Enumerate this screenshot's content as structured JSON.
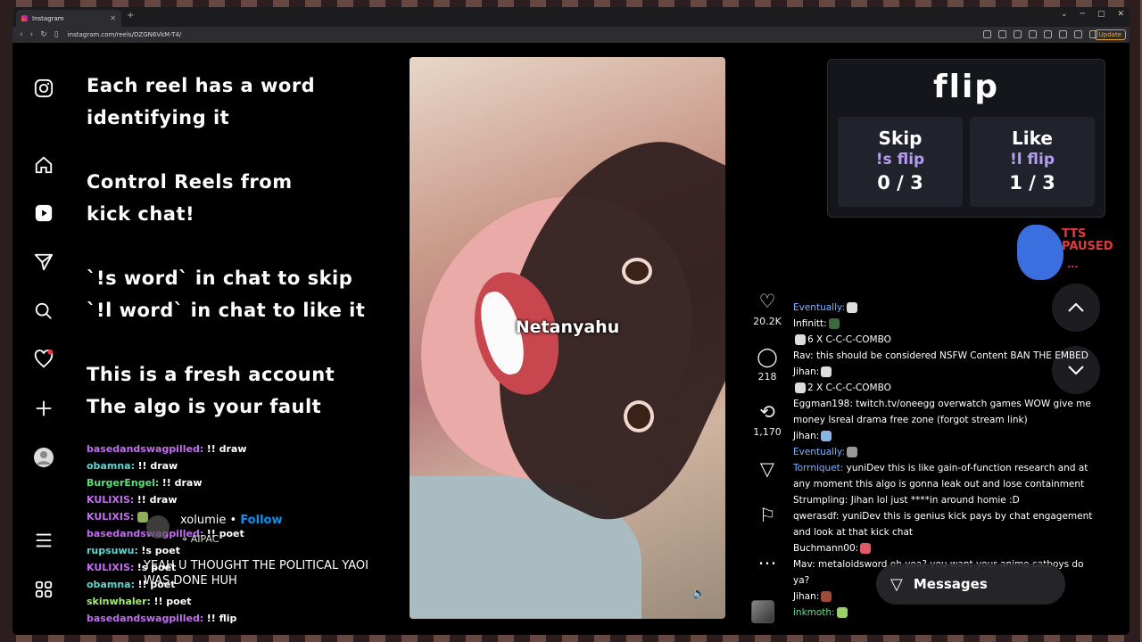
{
  "browser": {
    "tab_title": "Instagram",
    "tab_close": "✕",
    "new_tab": "+",
    "url": "instagram.com/reels/DZGN6VkM-T4/",
    "update_label": "Update",
    "win_min": "─",
    "win_max": "▢",
    "win_close": "✕",
    "chevron": "⌄"
  },
  "overlay": {
    "line1": "Each reel has a word",
    "line2": "identifying it",
    "line3": "Control Reels from",
    "line4": "kick chat!",
    "line5": "`!s word` in chat to skip",
    "line6": "`!l word` in chat to like it",
    "line7": "This is a fresh account",
    "line8": "The algo is your fault"
  },
  "left_chat": [
    {
      "user": "basedandswagpilled:",
      "msg": "!! draw",
      "color": "#c36cf0"
    },
    {
      "user": "obamna:",
      "msg": "!! draw",
      "color": "#5fd7d0"
    },
    {
      "user": "BurgerEngel:",
      "msg": "!! draw",
      "color": "#59e07a"
    },
    {
      "user": "KULIXIS:",
      "msg": "!! draw",
      "color": "#c36cf0"
    },
    {
      "user": "KULIXIS:",
      "msg": "",
      "color": "#c36cf0"
    },
    {
      "user": "basedandswagpilled:",
      "msg": "!! poet",
      "color": "#c36cf0"
    },
    {
      "user": "rupsuwu:",
      "msg": "!s poet",
      "color": "#5fd7d0"
    },
    {
      "user": "KULIXIS:",
      "msg": "!s poet",
      "color": "#c36cf0"
    },
    {
      "user": "obamna:",
      "msg": "!! poet",
      "color": "#5fd7d0"
    },
    {
      "user": "skinwhaler:",
      "msg": "!! poet",
      "color": "#a6e87a"
    },
    {
      "user": "basedandswagpilled:",
      "msg": "!! flip",
      "color": "#c36cf0"
    }
  ],
  "reel": {
    "follow_user": "xolumie",
    "follow_sep": "•",
    "follow_label": "Follow",
    "location": "AIPAC",
    "caption_line1": "YEAH U THOUGHT THE POLITICAL YAOI",
    "caption_line2": "WAS DONE HUH",
    "video_word": "Netanyahu",
    "likes": "20.2K",
    "comments": "218",
    "reposts": "1,170",
    "more": "…"
  },
  "flip_panel": {
    "title": "flip",
    "skip_label": "Skip",
    "skip_cmd": "!s flip",
    "skip_count": "0 / 3",
    "like_label": "Like",
    "like_cmd": "!l flip",
    "like_count": "1 / 3"
  },
  "tts": {
    "line1": "TTS",
    "line2": "PAUSED",
    "dots": "..."
  },
  "right_chat": [
    {
      "user": "Eventually:",
      "msg": "",
      "color": "#7ab4ff"
    },
    {
      "user": "Infinitt:",
      "msg": "",
      "color": "#ffffff"
    },
    {
      "user": "",
      "msg": "6 X C-C-C-COMBO",
      "color": "#ffffff"
    },
    {
      "user": "Rav:",
      "msg": "this should be considered NSFW Content  BAN THE EMBED",
      "color": "#ffffff"
    },
    {
      "user": "Jihan:",
      "msg": "",
      "color": "#ffffff"
    },
    {
      "user": "",
      "msg": "2 X C-C-C-COMBO",
      "color": "#ffffff"
    },
    {
      "user": "Eggman198:",
      "msg": "twitch.tv/oneegg  overwatch games WOW  give me money  Isreal drama free zone (forgot stream link)",
      "color": "#ffffff"
    },
    {
      "user": "Jihan:",
      "msg": "",
      "color": "#ffffff"
    },
    {
      "user": "Eventually:",
      "msg": "",
      "color": "#7ab4ff"
    },
    {
      "user": "Torrniquet:",
      "msg": "yuniDev this is like gain-of-function research and at any moment this algo is gonna leak out and lose containment",
      "color": "#7ab4ff"
    },
    {
      "user": "Strumpling:",
      "msg": "Jihan lol just ****in around homie :D",
      "color": "#ffffff"
    },
    {
      "user": "qwerasdf:",
      "msg": "yuniDev this is genius kick pays by chat engagement and look at that kick chat",
      "color": "#ffffff"
    },
    {
      "user": "Buchmann00:",
      "msg": "",
      "color": "#ffffff"
    },
    {
      "user": "Mav:",
      "msg": "metaloidsword oh yea? you want your anime catboys do ya?",
      "color": "#ffffff"
    },
    {
      "user": "Jihan:",
      "msg": "",
      "color": "#ffffff"
    },
    {
      "user": "inkmoth:",
      "msg": "",
      "color": "#5fe08a"
    }
  ],
  "messages_label": "Messages"
}
